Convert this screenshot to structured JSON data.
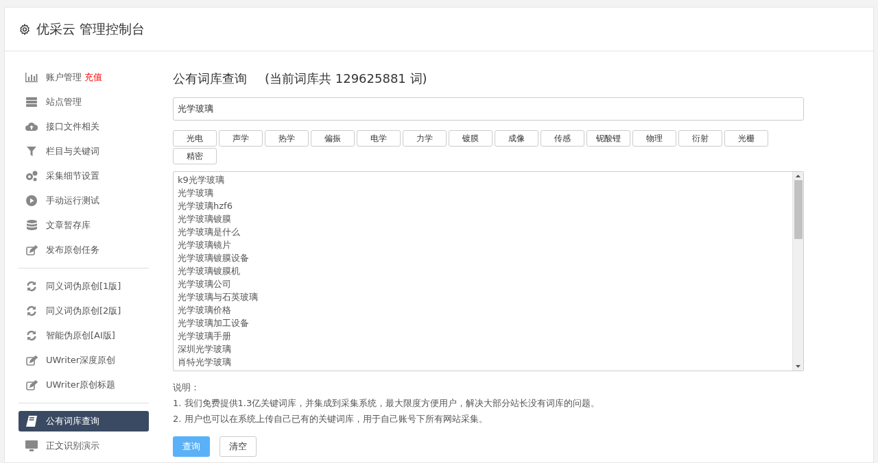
{
  "header": {
    "title": "优采云 管理控制台"
  },
  "sidebar": {
    "groups": [
      {
        "items": [
          {
            "label": "账户管理",
            "badge": "充值",
            "selected": false
          },
          {
            "label": "站点管理",
            "selected": false
          },
          {
            "label": "接口文件相关",
            "selected": false
          },
          {
            "label": "栏目与关键词",
            "selected": false
          },
          {
            "label": "采集细节设置",
            "selected": false
          },
          {
            "label": "手动运行测试",
            "selected": false
          },
          {
            "label": "文章暂存库",
            "selected": false
          },
          {
            "label": "发布原创任务",
            "selected": false
          }
        ]
      },
      {
        "items": [
          {
            "label": "同义词伪原创[1版]",
            "selected": false
          },
          {
            "label": "同义词伪原创[2版]",
            "selected": false
          },
          {
            "label": "智能伪原创[AI版]",
            "selected": false
          },
          {
            "label": "UWriter深度原创",
            "selected": false
          },
          {
            "label": "UWriter原创标题",
            "selected": false
          }
        ]
      },
      {
        "items": [
          {
            "label": "公有词库查询",
            "selected": true
          },
          {
            "label": "正文识别演示",
            "selected": false
          }
        ]
      }
    ]
  },
  "main": {
    "title": "公有词库查询",
    "count_note": "(当前词库共 129625881 词)",
    "search": {
      "value": "光学玻璃"
    },
    "tags": [
      "光电",
      "声学",
      "热学",
      "偏振",
      "电学",
      "力学",
      "镀膜",
      "成像",
      "传感",
      "铌酸锂",
      "物理",
      "衍射",
      "光栅",
      "精密"
    ],
    "results": [
      "k9光学玻璃",
      "光学玻璃",
      "光学玻璃hzf6",
      "光学玻璃镀膜",
      "光学玻璃是什么",
      "光学玻璃镜片",
      "光学玻璃镀膜设备",
      "光学玻璃镀膜机",
      "光学玻璃公司",
      "光学玻璃与石英玻璃",
      "光学玻璃价格",
      "光学玻璃加工设备",
      "光学玻璃手册",
      "深圳光学玻璃",
      "肖特光学玻璃"
    ],
    "notes_title": "说明：",
    "notes": [
      "1. 我们免费提供1.3亿关键词库，并集成到采集系统，最大限度方便用户，解决大部分站长没有词库的问题。",
      "2. 用户也可以在系统上传自己已有的关键词库，用于自己账号下所有网站采集。"
    ],
    "buttons": [
      {
        "label": "查询",
        "kind": "primary"
      },
      {
        "label": "清空",
        "kind": "default"
      }
    ]
  }
}
